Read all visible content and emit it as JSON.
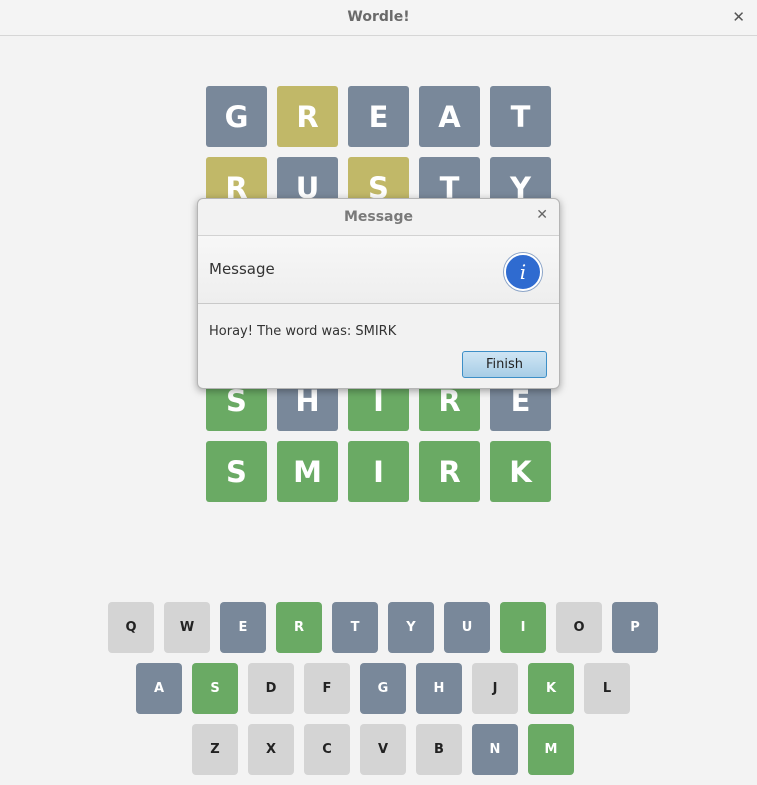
{
  "window": {
    "title": "Wordle!"
  },
  "colors": {
    "green": "#6aaa64",
    "yellow": "#c1b868",
    "gray": "#79889a",
    "unused": "#d4d4d4"
  },
  "grid": [
    [
      {
        "letter": "G",
        "state": "gray"
      },
      {
        "letter": "R",
        "state": "yellow"
      },
      {
        "letter": "E",
        "state": "gray"
      },
      {
        "letter": "A",
        "state": "gray"
      },
      {
        "letter": "T",
        "state": "gray"
      }
    ],
    [
      {
        "letter": "R",
        "state": "yellow"
      },
      {
        "letter": "U",
        "state": "gray"
      },
      {
        "letter": "S",
        "state": "yellow"
      },
      {
        "letter": "T",
        "state": "gray"
      },
      {
        "letter": "Y",
        "state": "gray"
      }
    ],
    [
      {
        "letter": "",
        "state": "gray"
      },
      {
        "letter": "",
        "state": "gray"
      },
      {
        "letter": "",
        "state": "gray"
      },
      {
        "letter": "",
        "state": "gray"
      },
      {
        "letter": "",
        "state": "gray"
      }
    ],
    [
      {
        "letter": "",
        "state": "gray"
      },
      {
        "letter": "",
        "state": "gray"
      },
      {
        "letter": "",
        "state": "gray"
      },
      {
        "letter": "",
        "state": "gray"
      },
      {
        "letter": "",
        "state": "gray"
      }
    ],
    [
      {
        "letter": "S",
        "state": "green"
      },
      {
        "letter": "H",
        "state": "gray"
      },
      {
        "letter": "I",
        "state": "green"
      },
      {
        "letter": "R",
        "state": "green"
      },
      {
        "letter": "E",
        "state": "gray"
      }
    ],
    [
      {
        "letter": "S",
        "state": "green"
      },
      {
        "letter": "M",
        "state": "green"
      },
      {
        "letter": "I",
        "state": "green"
      },
      {
        "letter": "R",
        "state": "green"
      },
      {
        "letter": "K",
        "state": "green"
      }
    ]
  ],
  "keyboard": [
    [
      {
        "key": "Q",
        "state": "unused"
      },
      {
        "key": "W",
        "state": "unused"
      },
      {
        "key": "E",
        "state": "gray"
      },
      {
        "key": "R",
        "state": "green"
      },
      {
        "key": "T",
        "state": "gray"
      },
      {
        "key": "Y",
        "state": "gray"
      },
      {
        "key": "U",
        "state": "gray"
      },
      {
        "key": "I",
        "state": "green"
      },
      {
        "key": "O",
        "state": "unused"
      },
      {
        "key": "P",
        "state": "gray"
      }
    ],
    [
      {
        "key": "A",
        "state": "gray"
      },
      {
        "key": "S",
        "state": "green"
      },
      {
        "key": "D",
        "state": "unused"
      },
      {
        "key": "F",
        "state": "unused"
      },
      {
        "key": "G",
        "state": "gray"
      },
      {
        "key": "H",
        "state": "gray"
      },
      {
        "key": "J",
        "state": "unused"
      },
      {
        "key": "K",
        "state": "green"
      },
      {
        "key": "L",
        "state": "unused"
      }
    ],
    [
      {
        "key": "Z",
        "state": "unused"
      },
      {
        "key": "X",
        "state": "unused"
      },
      {
        "key": "C",
        "state": "unused"
      },
      {
        "key": "V",
        "state": "unused"
      },
      {
        "key": "B",
        "state": "unused"
      },
      {
        "key": "N",
        "state": "gray"
      },
      {
        "key": "M",
        "state": "green"
      }
    ]
  ],
  "dialog": {
    "title": "Message",
    "header": "Message",
    "icon": "info-icon",
    "body": "Horay! The word was: SMIRK",
    "button": "Finish"
  }
}
